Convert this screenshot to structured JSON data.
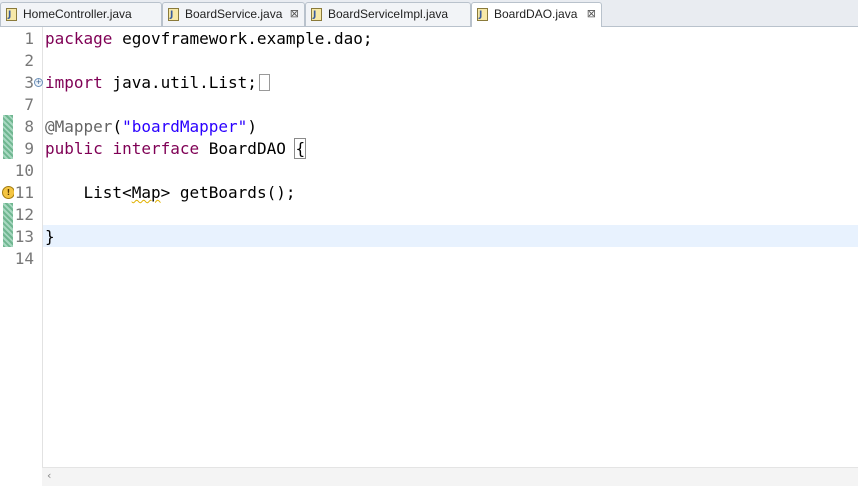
{
  "tabs": [
    {
      "label": "HomeController.java",
      "active": false,
      "closable": false
    },
    {
      "label": "BoardService.java",
      "active": false,
      "closable": true
    },
    {
      "label": "BoardServiceImpl.java",
      "active": false,
      "closable": false
    },
    {
      "label": "BoardDAO.java",
      "active": true,
      "closable": true
    }
  ],
  "close_glyph": "⊠",
  "editor": {
    "line_numbers": [
      "1",
      "2",
      "3",
      "7",
      "8",
      "9",
      "10",
      "11",
      "12",
      "13",
      "14"
    ],
    "code": {
      "l1_kw": "package",
      "l1_rest": " egovframework.example.dao;",
      "l3_kw": "import",
      "l3_rest": " java.util.List;",
      "l8_ann": "@Mapper",
      "l8_open": "(",
      "l8_str": "\"boardMapper\"",
      "l8_close": ")",
      "l9_kw1": "public",
      "l9_kw2": "interface",
      "l9_name": " BoardDAO ",
      "l9_brace": "{",
      "l11_indent": "    List<",
      "l11_map": "Map",
      "l11_rest": "> getBoards();",
      "l13_brace": "}"
    }
  },
  "colors": {
    "keyword": "#7f0055",
    "annotation": "#646464",
    "string": "#2a00ff",
    "current_line": "#e8f2fe"
  },
  "icons": {
    "tab_file": "java-file-icon",
    "expand": "expand-fold-icon",
    "warning": "warning-marker-icon",
    "scroll_left": "scroll-left-arrow-icon"
  }
}
